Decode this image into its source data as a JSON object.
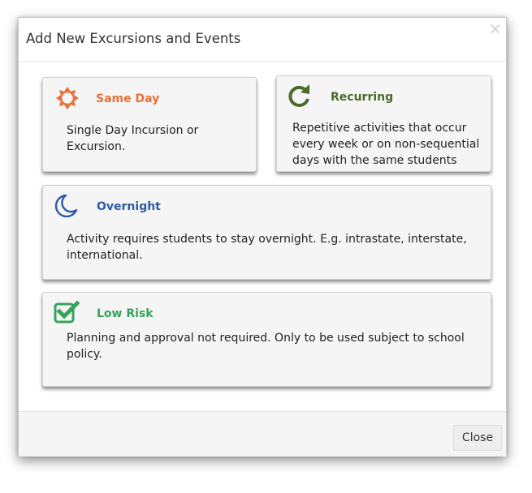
{
  "dialog": {
    "title": "Add New Excursions and Events",
    "close_symbol": "×"
  },
  "cards": {
    "same_day": {
      "title": "Same Day",
      "description": "Single Day Incursion or Excursion.",
      "icon": "sun-icon",
      "color": "#e8703a"
    },
    "recurring": {
      "title": "Recurring",
      "description_lines": [
        "Repetitive activities that occur",
        "every week or on non-sequential",
        "days with the same students"
      ],
      "icon": "recurring-arrow-icon",
      "color": "#4a6b2a"
    },
    "overnight": {
      "title": "Overnight",
      "description_lines": [
        "Activity requires students to stay overnight. E.g. intrastate, interstate,",
        "international."
      ],
      "icon": "moon-icon",
      "color": "#2e5aa7"
    },
    "low_risk": {
      "title": "Low Risk",
      "description_lines": [
        "Planning and approval not required. Only to be used subject to school",
        "policy."
      ],
      "icon": "checkbox-icon",
      "color": "#36a35a"
    }
  },
  "footer": {
    "close_label": "Close"
  }
}
